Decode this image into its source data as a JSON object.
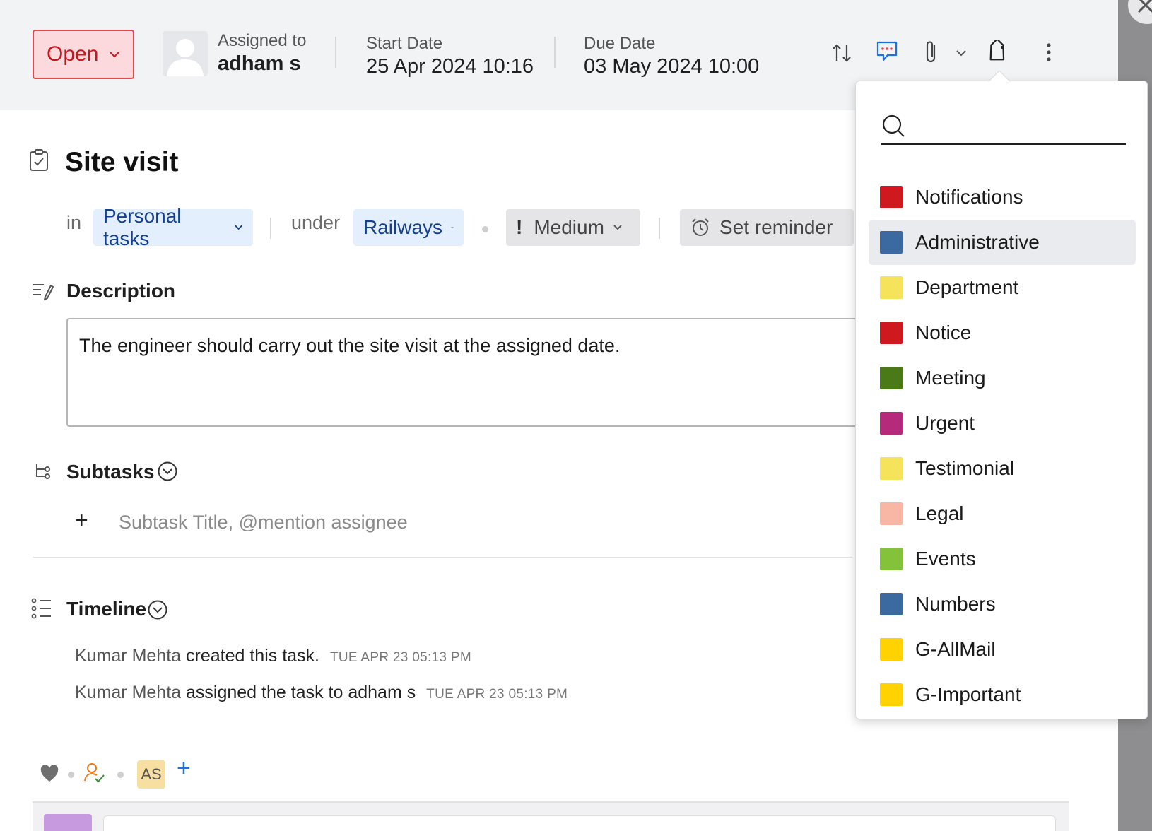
{
  "header": {
    "status": "Open",
    "assigned_label": "Assigned to",
    "assigned_value": "adham s",
    "start_label": "Start Date",
    "start_value": "25 Apr 2024 10:16",
    "due_label": "Due Date",
    "due_value": "03 May 2024 10:00"
  },
  "task": {
    "title": "Site visit",
    "in_label": "in",
    "list": "Personal tasks",
    "under_label": "under",
    "project": "Railways",
    "priority_mark": "!",
    "priority": "Medium",
    "reminder": "Set reminder"
  },
  "description": {
    "heading": "Description",
    "text": "The engineer should carry out the site visit at the assigned date."
  },
  "subtasks": {
    "heading": "Subtasks",
    "add": "+",
    "placeholder": "Subtask Title, @mention assignee"
  },
  "timeline": {
    "heading": "Timeline",
    "entries": [
      {
        "actor": "Kumar Mehta",
        "action": "created this task.",
        "time": "TUE APR 23 05:13 PM"
      },
      {
        "actor": "Kumar Mehta",
        "action": "assigned the task to adham s",
        "time": "TUE APR 23 05:13 PM"
      }
    ]
  },
  "footer": {
    "initials": "AS",
    "add": "+"
  },
  "tags_dropdown": {
    "search_value": "",
    "items": [
      {
        "label": "Notifications",
        "color": "#d0191f"
      },
      {
        "label": "Administrative",
        "color": "#3a6aa0"
      },
      {
        "label": "Department",
        "color": "#f5e35c"
      },
      {
        "label": "Notice",
        "color": "#d0191f"
      },
      {
        "label": "Meeting",
        "color": "#4a7a18"
      },
      {
        "label": "Urgent",
        "color": "#b52a7a"
      },
      {
        "label": "Testimonial",
        "color": "#f5e35c"
      },
      {
        "label": "Legal",
        "color": "#f8b6a4"
      },
      {
        "label": "Events",
        "color": "#84c23a"
      },
      {
        "label": "Numbers",
        "color": "#3a6aa0"
      },
      {
        "label": "G-AllMail",
        "color": "#ffd200"
      },
      {
        "label": "G-Important",
        "color": "#ffd200"
      }
    ]
  }
}
